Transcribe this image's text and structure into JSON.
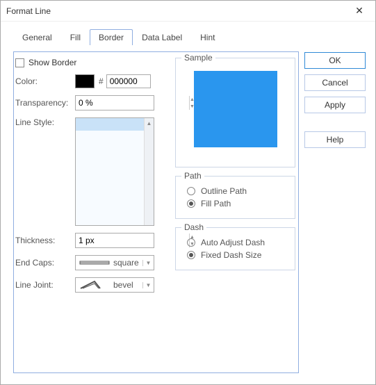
{
  "window": {
    "title": "Format Line"
  },
  "tabs": {
    "general": "General",
    "fill": "Fill",
    "border": "Border",
    "datalabel": "Data Label",
    "hint": "Hint"
  },
  "border": {
    "show_border": "Show Border",
    "color_label": "Color:",
    "color_hex": "000000",
    "transparency_label": "Transparency:",
    "transparency_value": "0 %",
    "linestyle_label": "Line Style:",
    "thickness_label": "Thickness:",
    "thickness_value": "1 px",
    "endcaps_label": "End Caps:",
    "endcaps_value": "square",
    "linejoint_label": "Line Joint:",
    "linejoint_value": "bevel"
  },
  "sample": {
    "legend": "Sample",
    "color": "#2a96ee"
  },
  "path": {
    "legend": "Path",
    "outline": "Outline Path",
    "fill": "Fill Path"
  },
  "dash": {
    "legend": "Dash",
    "auto": "Auto Adjust Dash",
    "fixed": "Fixed Dash Size"
  },
  "buttons": {
    "ok": "OK",
    "cancel": "Cancel",
    "apply": "Apply",
    "help": "Help"
  }
}
